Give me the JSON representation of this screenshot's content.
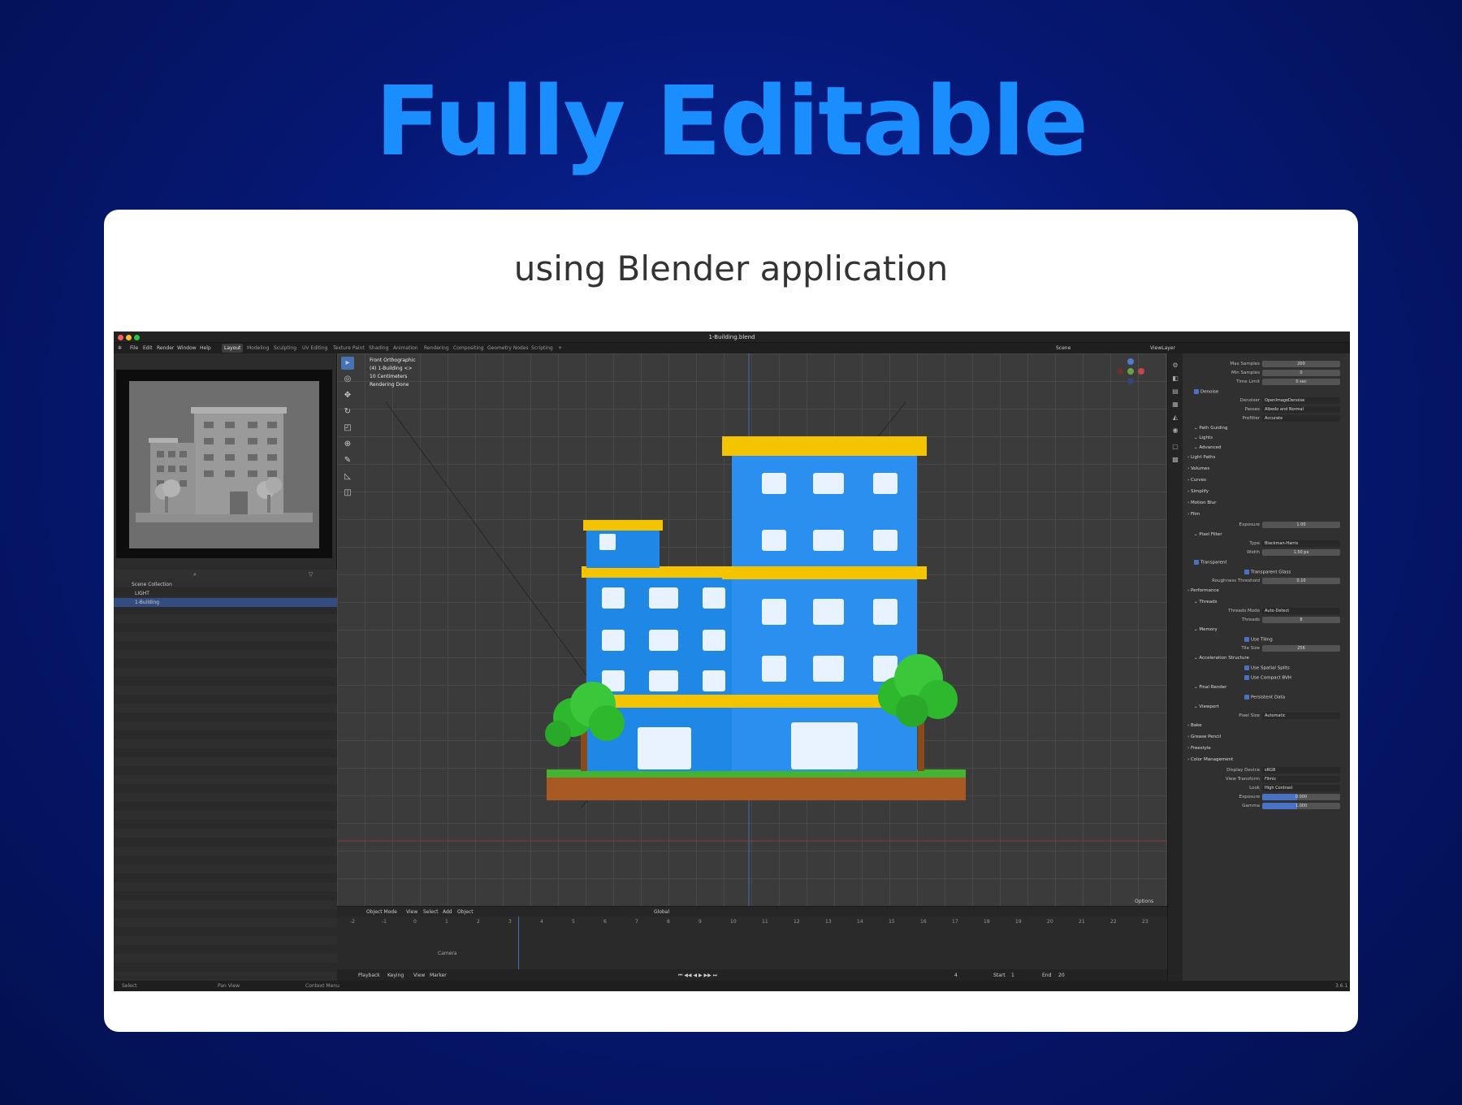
{
  "headline": "Fully Editable",
  "subheading": "using Blender application",
  "app": {
    "title": "1-Building.blend",
    "menus": [
      "File",
      "Edit",
      "Render",
      "Window",
      "Help"
    ],
    "workspaces": [
      "Layout",
      "Modeling",
      "Sculpting",
      "UV Editing",
      "Texture Paint",
      "Shading",
      "Animation",
      "Rendering",
      "Compositing",
      "Geometry Nodes",
      "Scripting",
      "+"
    ],
    "active_workspace": "Layout",
    "scene": "Scene",
    "view_layer": "ViewLayer",
    "viewport_info": [
      "Front Orthographic",
      "(4) 1-Building <>",
      "10 Centimeters",
      "Rendering Done"
    ],
    "outliner": {
      "root": "Scene Collection",
      "items": [
        "LIGHT",
        "1-Building"
      ],
      "selected": "1-Building"
    },
    "viewport_header": {
      "mode": "Object Mode",
      "menus": [
        "View",
        "Select",
        "Add",
        "Object"
      ],
      "orientation": "Global",
      "options": "Options"
    },
    "timeline": {
      "ticks": [
        "-2",
        "-1",
        "0",
        "1",
        "2",
        "3",
        "4",
        "5",
        "6",
        "7",
        "8",
        "9",
        "10",
        "11",
        "12",
        "13",
        "14",
        "15",
        "16",
        "17",
        "18",
        "19",
        "20",
        "21",
        "22",
        "23"
      ],
      "current_frame": "4",
      "channel": "Camera",
      "menus": [
        "Playback",
        "Keying",
        "View",
        "Marker"
      ],
      "frame": "4",
      "start_label": "Start",
      "start": "1",
      "end_label": "End",
      "end": "20"
    },
    "properties": [
      {
        "kind": "field",
        "label": "Max Samples",
        "value": "200"
      },
      {
        "kind": "field",
        "label": "Min Samples",
        "value": "0"
      },
      {
        "kind": "field",
        "label": "Time Limit",
        "value": "0 sec"
      },
      {
        "kind": "check",
        "label": "Denoise"
      },
      {
        "kind": "dropdown",
        "label": "Denoiser",
        "value": "OpenImageDenoise"
      },
      {
        "kind": "dropdown",
        "label": "Passes",
        "value": "Albedo and Normal"
      },
      {
        "kind": "dropdown",
        "label": "Prefilter",
        "value": "Accurate"
      },
      {
        "kind": "sub",
        "label": "Path Guiding"
      },
      {
        "kind": "sub",
        "label": "Lights"
      },
      {
        "kind": "sub",
        "label": "Advanced"
      },
      {
        "kind": "section",
        "label": "Light Paths"
      },
      {
        "kind": "section",
        "label": "Volumes"
      },
      {
        "kind": "section",
        "label": "Curves"
      },
      {
        "kind": "section",
        "label": "Simplify"
      },
      {
        "kind": "section",
        "label": "Motion Blur"
      },
      {
        "kind": "section",
        "label": "Film"
      },
      {
        "kind": "field",
        "label": "Exposure",
        "value": "1.00"
      },
      {
        "kind": "sub",
        "label": "Pixel Filter"
      },
      {
        "kind": "dropdown",
        "label": "Type",
        "value": "Blackman-Harris"
      },
      {
        "kind": "field",
        "label": "Width",
        "value": "1.50 px"
      },
      {
        "kind": "check",
        "label": "Transparent"
      },
      {
        "kind": "checkv",
        "label": "Transparent Glass"
      },
      {
        "kind": "field",
        "label": "Roughness Threshold",
        "value": "0.10"
      },
      {
        "kind": "section",
        "label": "Performance"
      },
      {
        "kind": "sub",
        "label": "Threads"
      },
      {
        "kind": "dropdown",
        "label": "Threads Mode",
        "value": "Auto-Detect"
      },
      {
        "kind": "field",
        "label": "Threads",
        "value": "8"
      },
      {
        "kind": "sub",
        "label": "Memory"
      },
      {
        "kind": "checkv",
        "label": "Use Tiling"
      },
      {
        "kind": "field",
        "label": "Tile Size",
        "value": "256"
      },
      {
        "kind": "sub",
        "label": "Acceleration Structure"
      },
      {
        "kind": "checkv",
        "label": "Use Spatial Splits"
      },
      {
        "kind": "checkv",
        "label": "Use Compact BVH"
      },
      {
        "kind": "sub",
        "label": "Final Render"
      },
      {
        "kind": "checkv",
        "label": "Persistent Data"
      },
      {
        "kind": "sub",
        "label": "Viewport"
      },
      {
        "kind": "dropdown",
        "label": "Pixel Size",
        "value": "Automatic"
      },
      {
        "kind": "section",
        "label": "Bake"
      },
      {
        "kind": "section",
        "label": "Grease Pencil"
      },
      {
        "kind": "section",
        "label": "Freestyle"
      },
      {
        "kind": "section",
        "label": "Color Management"
      },
      {
        "kind": "dropdown",
        "label": "Display Device",
        "value": "sRGB"
      },
      {
        "kind": "dropdown",
        "label": "View Transform",
        "value": "Filmic"
      },
      {
        "kind": "dropdown",
        "label": "Look",
        "value": "High Contrast"
      },
      {
        "kind": "slider",
        "label": "Exposure",
        "value": "0.000"
      },
      {
        "kind": "slider",
        "label": "Gamma",
        "value": "1.000"
      }
    ],
    "status": {
      "select": "Select",
      "pan": "Pan View",
      "context": "Context Menu",
      "version": "3.6.1"
    }
  },
  "colors": {
    "accent": "#1a8dff",
    "bg": "#061876",
    "building_blue": "#1f87e6",
    "building_yellow": "#f5c400",
    "tree_green": "#2eb82e"
  }
}
